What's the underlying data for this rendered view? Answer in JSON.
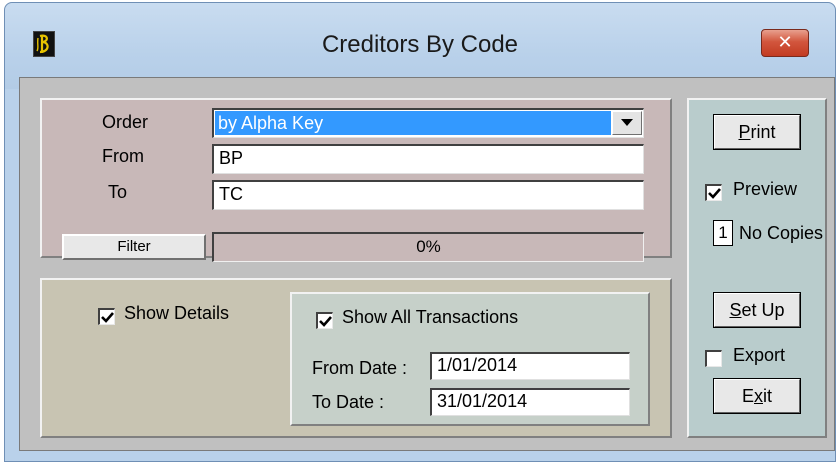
{
  "window": {
    "title": "Creditors By Code",
    "close_label": "✕"
  },
  "filters": {
    "order_label": "Order",
    "order_value": "by Alpha Key",
    "from_label": "From",
    "from_value": "BP",
    "to_label": "To",
    "to_value": "TC",
    "filter_button": "Filter",
    "progress_text": "0%",
    "progress_fraction": 0
  },
  "options": {
    "show_details_label": "Show Details",
    "show_details_checked": true,
    "show_all_label": "Show All Transactions",
    "show_all_checked": true,
    "from_date_label": "From Date :",
    "from_date_value": "1/01/2014",
    "to_date_label": "To Date :",
    "to_date_value": "31/01/2014"
  },
  "actions": {
    "print_label": "Print",
    "preview_label": "Preview",
    "preview_checked": true,
    "copies_value": "1",
    "copies_label": "No Copies",
    "setup_label": "Set Up",
    "export_label": "Export",
    "export_checked": false,
    "exit_label": "Exit"
  },
  "colors": {
    "selection": "#3399ff",
    "title_bar": "#b9d1ea",
    "close_button": "#c23b22"
  }
}
